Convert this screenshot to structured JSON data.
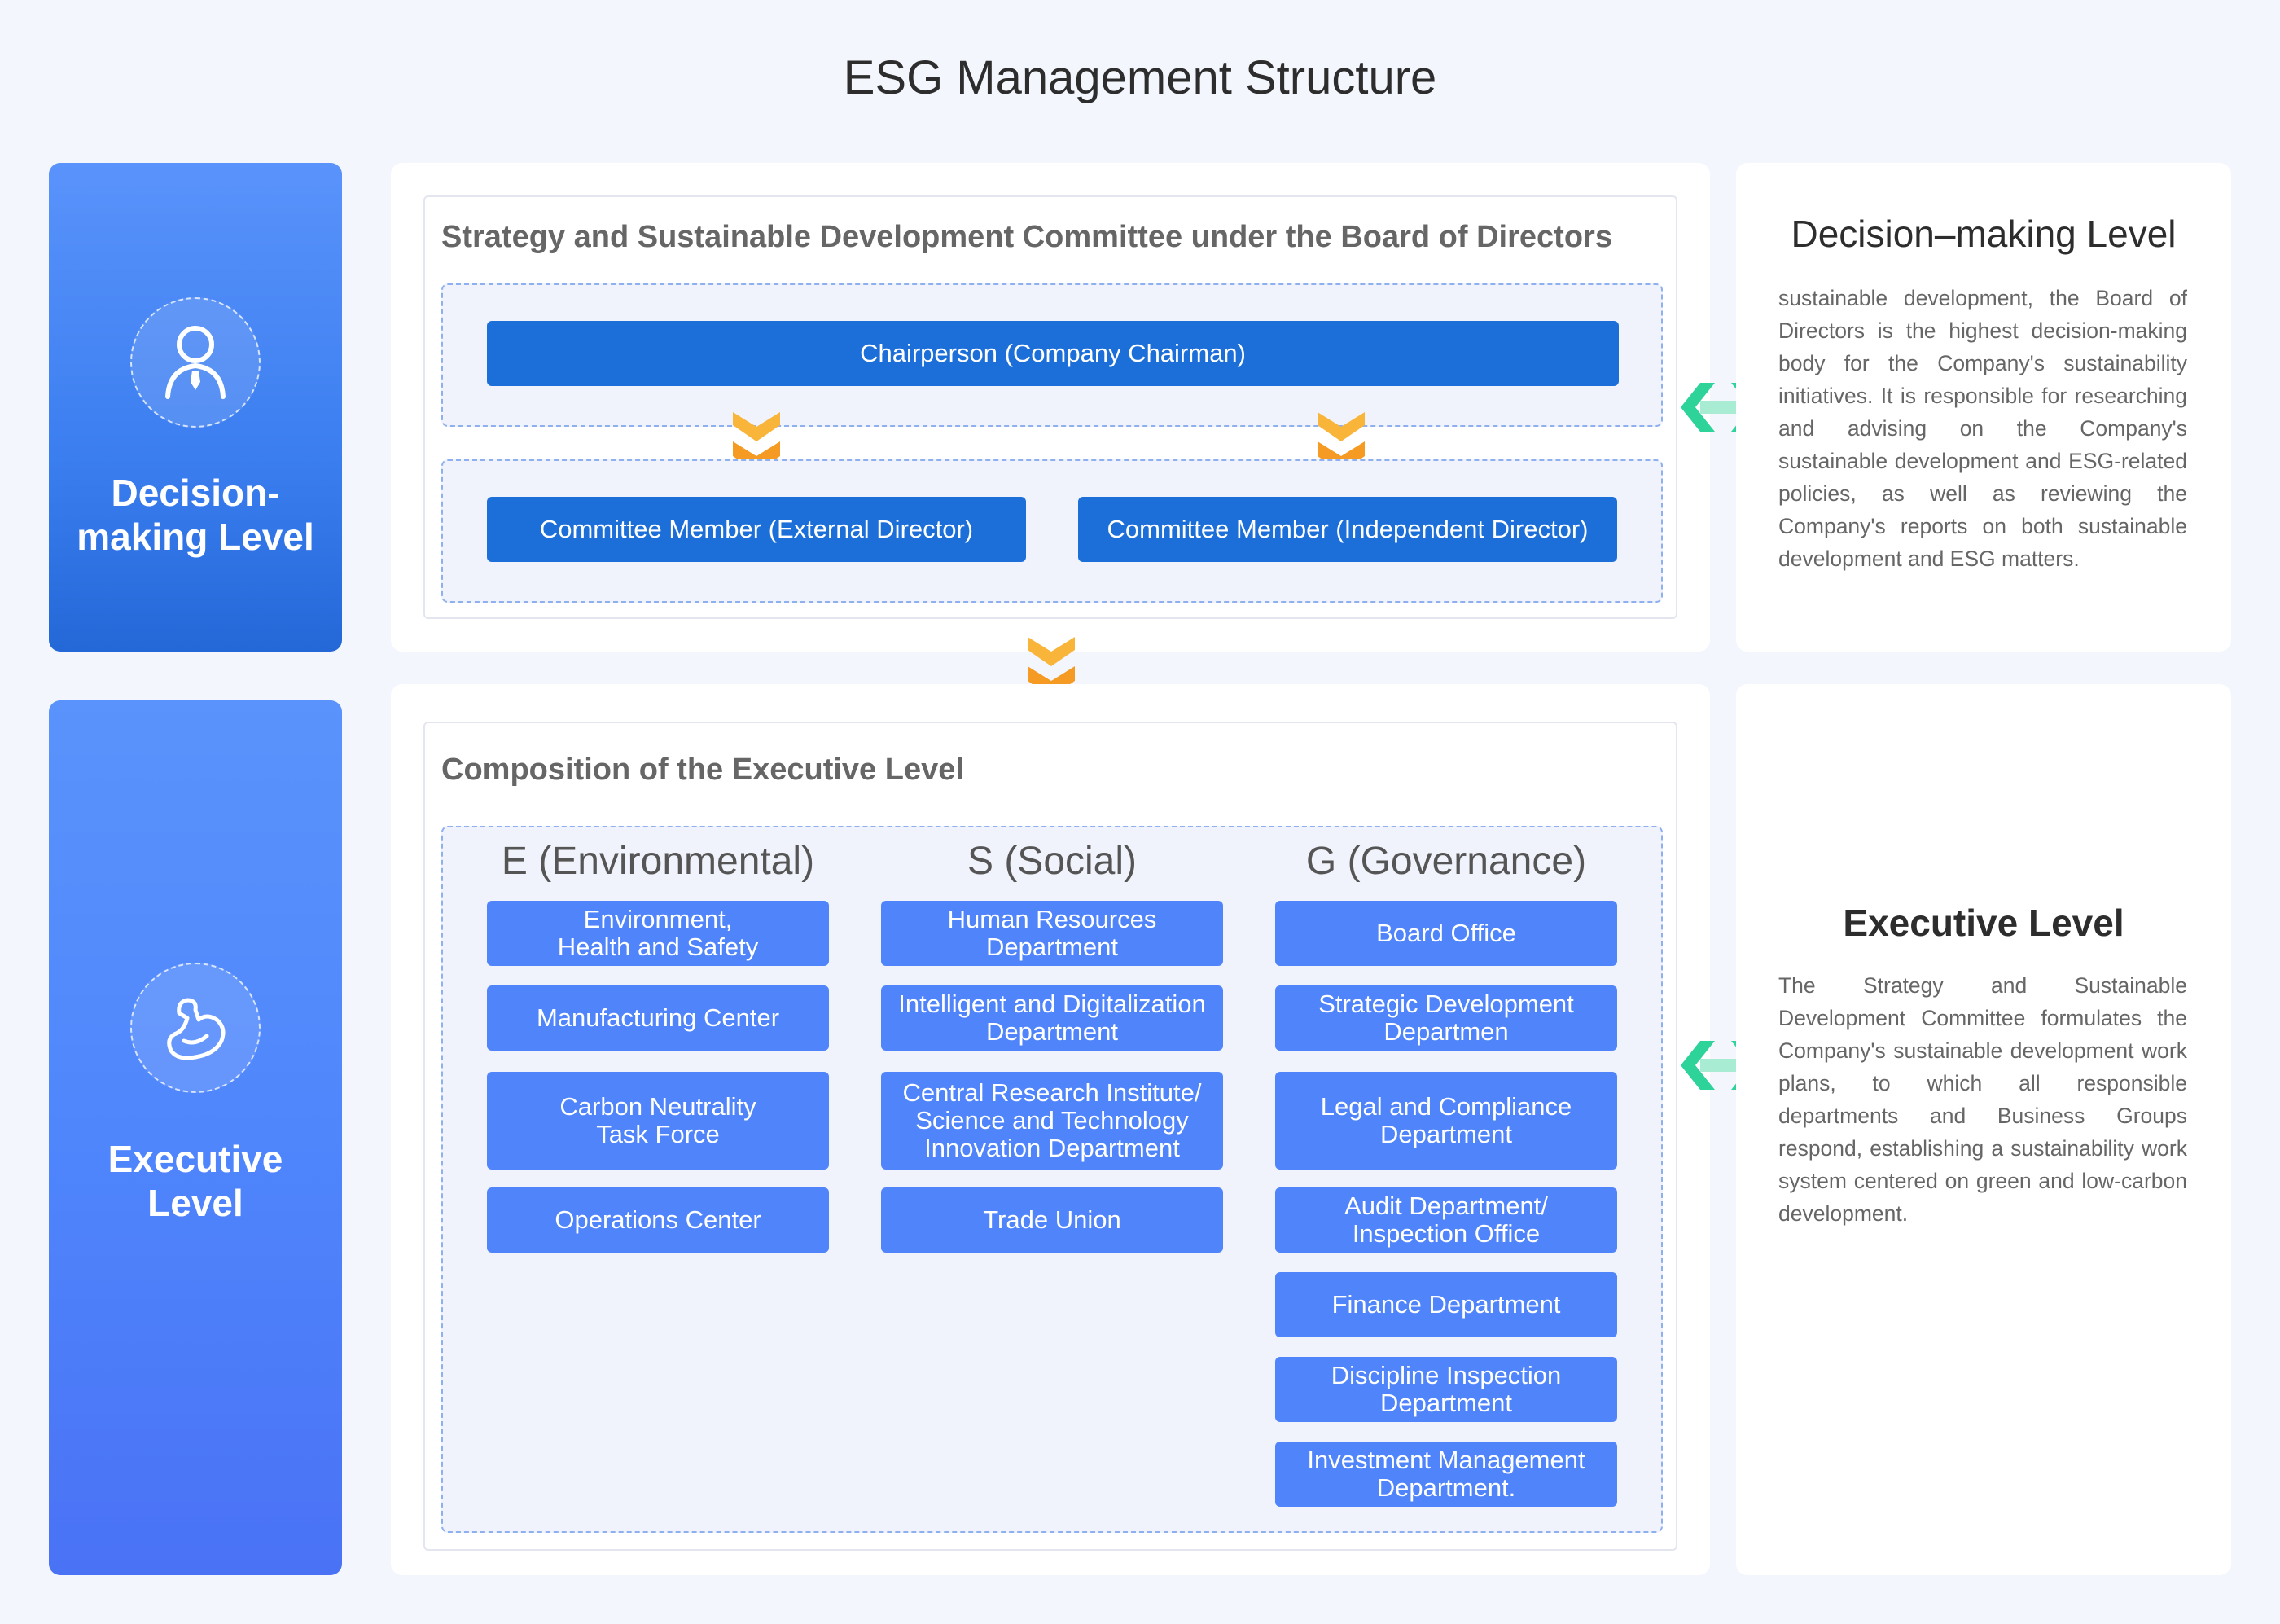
{
  "page_title": "ESG Management Structure",
  "decision": {
    "side_label": "Decision-\nmaking Level",
    "panel_title": "Strategy and Sustainable Development Committee under the Board of Directors",
    "chair": "Chairperson (Company Chairman)",
    "members": [
      "Committee Member (External Director)",
      "Committee Member (Independent Director)"
    ],
    "desc_title": "Decision–making Level",
    "desc_body": "sustainable development, the Board of Directors is the highest decision-making body for the Company's sustainability initiatives. It is responsible for researching and advising on the Company's sustainable development and ESG-related policies, as well as reviewing the Company's reports on both sustainable development and ESG matters."
  },
  "executive": {
    "side_label": "Executive\nLevel",
    "panel_title": "Composition of the Executive Level",
    "columns": [
      {
        "heading": "E (Environmental)",
        "items": [
          "Environment,\nHealth and Safety",
          "Manufacturing Center",
          "Carbon Neutrality\nTask Force",
          "Operations Center"
        ]
      },
      {
        "heading": "S (Social)",
        "items": [
          "Human Resources\nDepartment",
          "Intelligent and Digitalization\nDepartment",
          "Central Research Institute/\nScience and Technology\nInnovation Department",
          "Trade Union"
        ]
      },
      {
        "heading": "G (Governance)",
        "items": [
          "Board Office",
          "Strategic Development\nDepartmen",
          "Legal and Compliance\nDepartment",
          "Audit Department/\nInspection Office",
          "Finance Department",
          "Discipline Inspection\nDepartment",
          "Investment Management\nDepartment."
        ]
      }
    ],
    "desc_title": "Executive Level",
    "desc_body": "The Strategy and Sustainable Development Committee formulates the Company's sustainable development work plans, to which all responsible departments and Business Groups respond, establishing a sustainability work system centered on green and low-carbon development."
  },
  "icons": {
    "decision_icon": "person-with-tie-icon",
    "executive_icon": "flexed-arm-icon",
    "flow_arrow": "double-chevron-down-icon",
    "link_arrow": "double-headed-arrow-icon"
  },
  "colors": {
    "primary_blue": "#1c6fd8",
    "executive_blue": "#4f84fa",
    "chevron_orange": "#f7a730",
    "link_green": "#2ed39a"
  }
}
